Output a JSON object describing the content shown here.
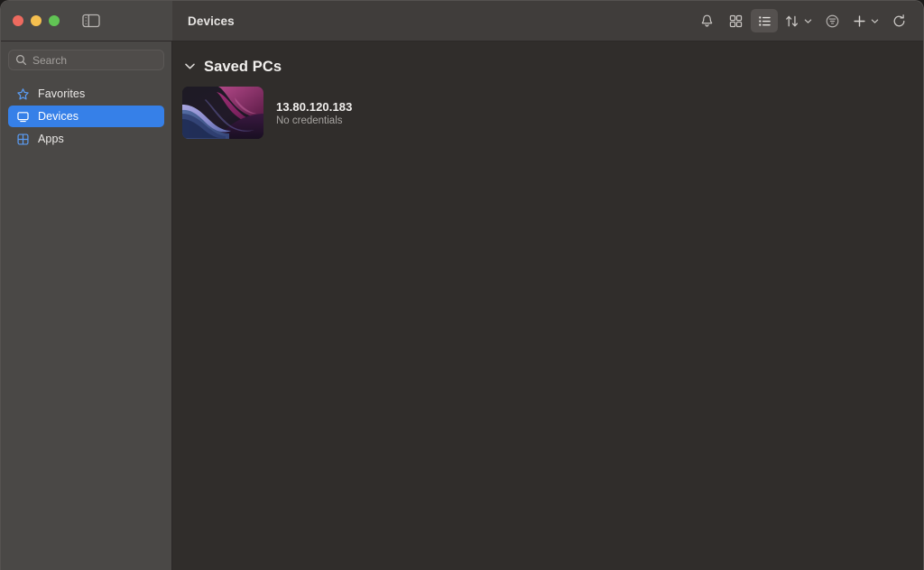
{
  "window": {
    "title": "Devices",
    "traffic_lights": [
      {
        "name": "close",
        "color": "#ee6a5f"
      },
      {
        "name": "minimize",
        "color": "#f5bf4f"
      },
      {
        "name": "zoom",
        "color": "#61c454"
      }
    ],
    "sidebar_toggle_icon": "sidebar-toggle-icon"
  },
  "toolbar": {
    "items": [
      {
        "name": "notifications-button",
        "icon": "bell-icon",
        "active": false
      },
      {
        "name": "grid-view-button",
        "icon": "grid-view-icon",
        "active": false
      },
      {
        "name": "list-view-button",
        "icon": "list-view-icon",
        "active": true
      },
      {
        "name": "sort-button",
        "icon": "sort-arrows-icon",
        "active": false,
        "chevron": true
      },
      {
        "name": "filter-button",
        "icon": "filter-circle-icon",
        "active": false
      },
      {
        "name": "add-button",
        "icon": "plus-icon",
        "active": false,
        "chevron": true
      },
      {
        "name": "refresh-button",
        "icon": "refresh-icon",
        "active": false
      }
    ]
  },
  "search": {
    "placeholder": "Search",
    "value": "",
    "icon": "search-icon"
  },
  "sidebar": {
    "items": [
      {
        "label": "Favorites",
        "icon": "star-icon",
        "selected": false
      },
      {
        "label": "Devices",
        "icon": "monitor-icon",
        "selected": true
      },
      {
        "label": "Apps",
        "icon": "apps-grid-icon",
        "selected": false
      }
    ]
  },
  "main": {
    "groups": [
      {
        "title": "Saved PCs",
        "expanded": true,
        "chevron_icon": "chevron-down-icon",
        "devices": [
          {
            "name": "13.80.120.183",
            "subtitle": "No credentials",
            "thumbnail": "windows-bloom-wallpaper"
          }
        ]
      }
    ]
  },
  "colors": {
    "accent": "#3680e8",
    "titlebar": "#403d3b",
    "sidebar": "#4a4846",
    "content": "#302d2b",
    "text_primary": "#f0eeec",
    "text_secondary": "#a6a3a0"
  }
}
